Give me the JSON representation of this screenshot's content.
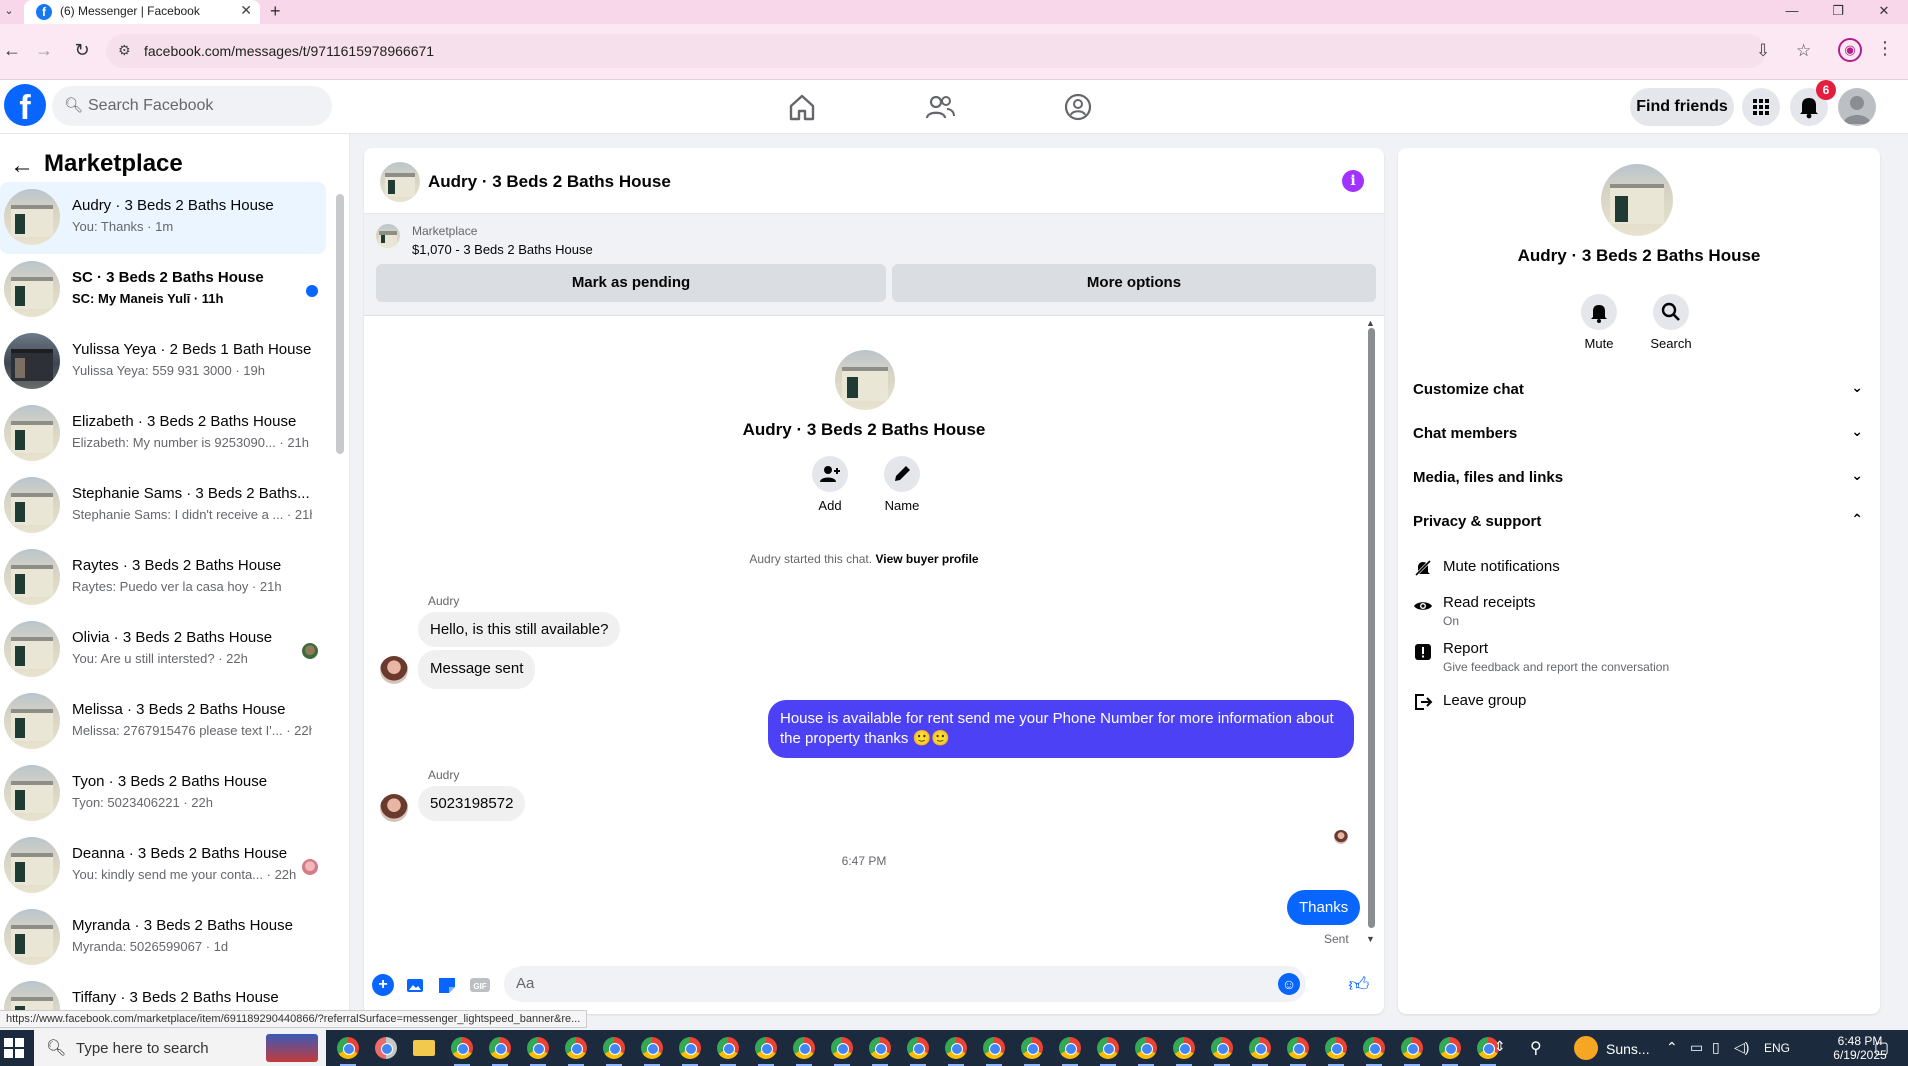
{
  "browser": {
    "tab_title": "(6) Messenger | Facebook",
    "new_tab": "+",
    "url": "facebook.com/messages/t/9711615978966671",
    "status_url": "https://www.facebook.com/marketplace/item/691189290440866/?referralSurface=messenger_lightspeed_banner&re..."
  },
  "header": {
    "search_placeholder": "Search Facebook",
    "find_friends": "Find friends",
    "notification_count": "6"
  },
  "left": {
    "title": "Marketplace",
    "conversations": [
      {
        "name": "Audry · 3 Beds 2 Baths House",
        "snippet": "You: Thanks · 1m"
      },
      {
        "name": "SC · 3 Beds 2 Baths House",
        "snippet": "SC: My Maneis Yulī · 11h"
      },
      {
        "name": "Yulissa Yeya · 2 Beds 1 Bath House",
        "snippet": "Yulissa Yeya: 559 931 3000 · 19h"
      },
      {
        "name": "Elizabeth · 3 Beds 2 Baths House",
        "snippet": "Elizabeth: My number is 9253090... · 21h"
      },
      {
        "name": "Stephanie Sams · 3 Beds 2 Baths...",
        "snippet": "Stephanie Sams: I didn't receive a ... · 21h"
      },
      {
        "name": "Raytes · 3 Beds 2 Baths House",
        "snippet": "Raytes: Puedo ver la casa hoy · 21h"
      },
      {
        "name": "Olivia · 3 Beds 2 Baths House",
        "snippet": "You: Are u still intersted? · 22h"
      },
      {
        "name": "Melissa · 3 Beds 2 Baths House",
        "snippet": "Melissa: 2767915476 please text I'... · 22h"
      },
      {
        "name": "Tyon · 3 Beds 2 Baths House",
        "snippet": "Tyon: 5023406221 · 22h"
      },
      {
        "name": "Deanna · 3 Beds 2 Baths House",
        "snippet": "You: kindly send me your conta... · 22h"
      },
      {
        "name": "Myranda · 3 Beds 2 Baths House",
        "snippet": "Myranda: 5026599067 · 1d"
      },
      {
        "name": "Tiffany · 3 Beds 2 Baths House",
        "snippet": ""
      }
    ]
  },
  "chat": {
    "title": "Audry · 3 Beds 2 Baths House",
    "info_icon": "i",
    "marketplace_label": "Marketplace",
    "listing": "$1,070 - 3 Beds 2 Baths House",
    "mark_pending": "Mark as pending",
    "more_options": "More options",
    "thread_name": "Audry · 3 Beds 2 Baths House",
    "add_label": "Add",
    "name_label": "Name",
    "started_text": "Audry started this chat.",
    "view_profile": "View buyer profile",
    "sender_1": "Audry",
    "msg_1": "Hello, is this still available?",
    "msg_2": "Message sent",
    "msg_3": "House is available for rent send me your Phone Number for more information about the property thanks 🙂🙂",
    "sender_2": "Audry",
    "msg_4": "5023198572",
    "timestamp": "6:47 PM",
    "msg_5": "Thanks",
    "sent_label": "Sent",
    "composer_placeholder": "Aa"
  },
  "right": {
    "name": "Audry · 3 Beds 2 Baths House",
    "mute": "Mute",
    "search": "Search",
    "sections": [
      "Customize chat",
      "Chat members",
      "Media, files and links",
      "Privacy & support"
    ],
    "mute_notifications": "Mute notifications",
    "read_receipts": "Read receipts",
    "read_receipts_state": "On",
    "report": "Report",
    "report_sub": "Give feedback and report the conversation",
    "leave_group": "Leave group"
  },
  "taskbar": {
    "search": "Type here to search",
    "weather": "Suns...",
    "lang": "ENG",
    "time": "6:48 PM",
    "date": "6/19/2025"
  }
}
